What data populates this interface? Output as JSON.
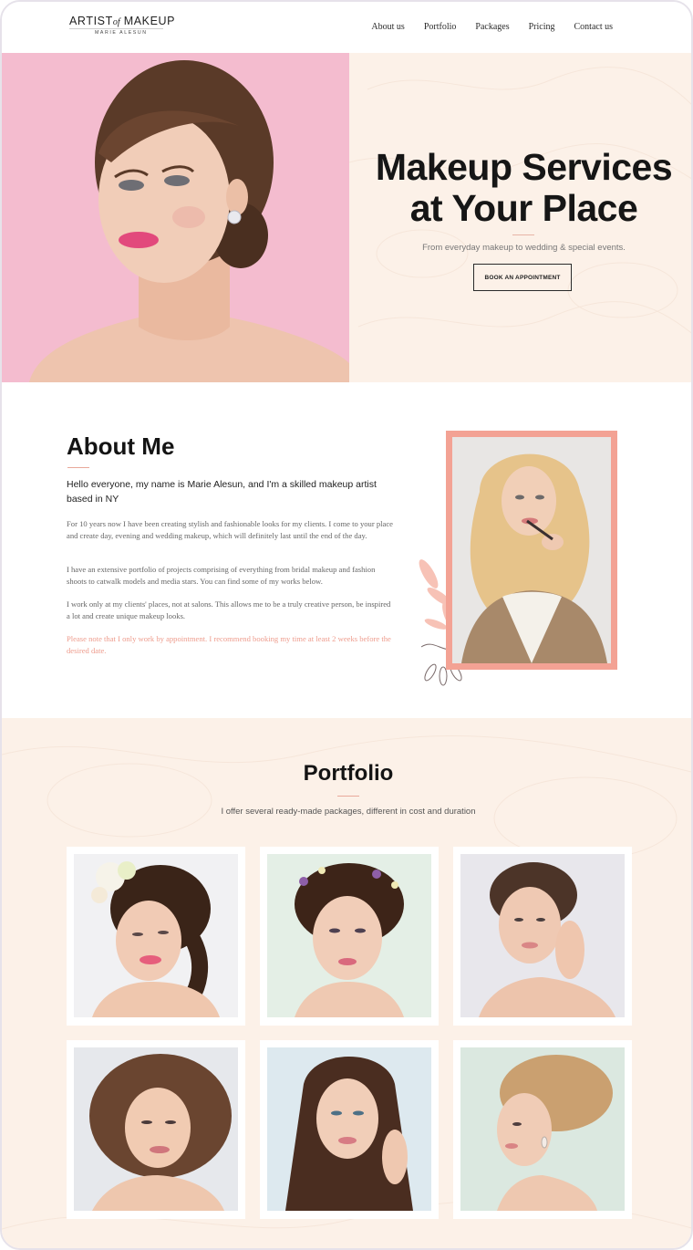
{
  "header": {
    "logo": {
      "part1": "ARTIST",
      "of": "of",
      "part2": "MAKEUP",
      "sub": "MARIE ALESUN"
    },
    "nav": [
      "About us",
      "Portfolio",
      "Packages",
      "Pricing",
      "Contact us"
    ]
  },
  "hero": {
    "title_line1": "Makeup Services",
    "title_line2": "at Your Place",
    "subtitle": "From everyday makeup to wedding & special events.",
    "button": "BOOK AN APPOINTMENT"
  },
  "about": {
    "title": "About Me",
    "lead": "Hello everyone, my name is Marie Alesun, and I'm a skilled makeup artist based in NY",
    "p1": "For 10 years now I have been creating stylish and fashionable looks for my clients. I come to your place and create day, evening and wedding makeup, which will definitely last until the end of the day.",
    "p2": "I have an extensive portfolio of projects comprising of everything from bridal makeup and fashion shoots to catwalk models and media stars. You can find some of my works below.",
    "p3": "I work only at my clients' places, not at salons. This allows me to be a truly creative person, be inspired a lot and create unique makeup looks.",
    "note": "Please note that I only work by appointment. I recommend booking my time at least 2 weeks before the desired date."
  },
  "portfolio": {
    "title": "Portfolio",
    "subtitle": "I offer several ready-made packages, different in cost and duration"
  },
  "colors": {
    "accent": "#f3a294",
    "cream": "#fcf1e8",
    "hero_pink": "#f4bccf"
  }
}
